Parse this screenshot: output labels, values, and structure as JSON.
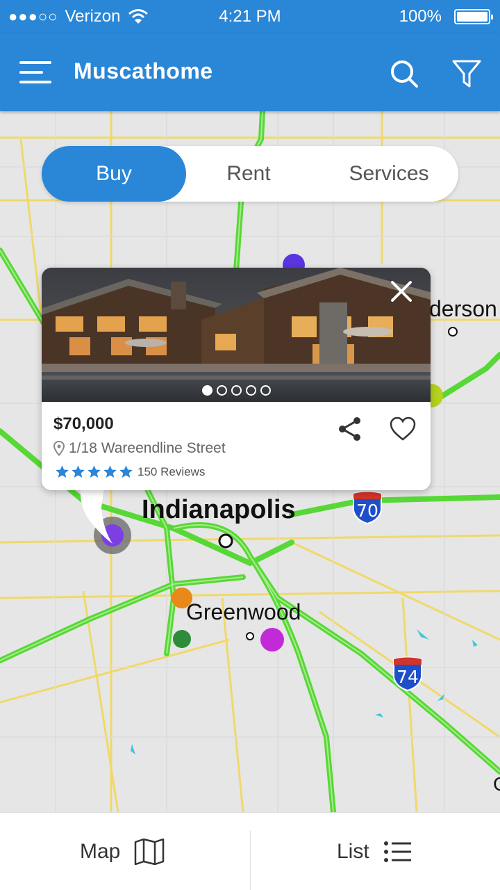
{
  "status_bar": {
    "signal_dots": "●●●○○",
    "carrier": "Verizon",
    "time": "4:21 PM",
    "battery": "100%"
  },
  "app_bar": {
    "title": "Muscathome"
  },
  "segments": [
    {
      "label": "Buy",
      "active": true
    },
    {
      "label": "Rent",
      "active": false
    },
    {
      "label": "Services",
      "active": false
    }
  ],
  "map": {
    "city_main": "Indianapolis",
    "city_secondary": "Greenwood",
    "city_partial": "derson",
    "highway_70": "70",
    "highway_74": "74",
    "edge_glyph": "G",
    "pin_colors": {
      "purple": "#7b3fe4",
      "orange": "#e8891a",
      "green": "#2e8b3a",
      "magenta": "#c22ad8",
      "lime": "#b5d21c",
      "indigo": "#5b35e0"
    }
  },
  "listing": {
    "price": "$70,000",
    "address": "1/18 Wareendline Street",
    "rating": 5,
    "reviews": "150 Reviews",
    "photo_count": 5,
    "active_photo": 1
  },
  "bottom_nav": {
    "map_label": "Map",
    "list_label": "List"
  },
  "colors": {
    "primary": "#2a86d6",
    "star": "#2a86d6",
    "road_green": "#5de03a",
    "road_yellow": "#f1d96a"
  }
}
